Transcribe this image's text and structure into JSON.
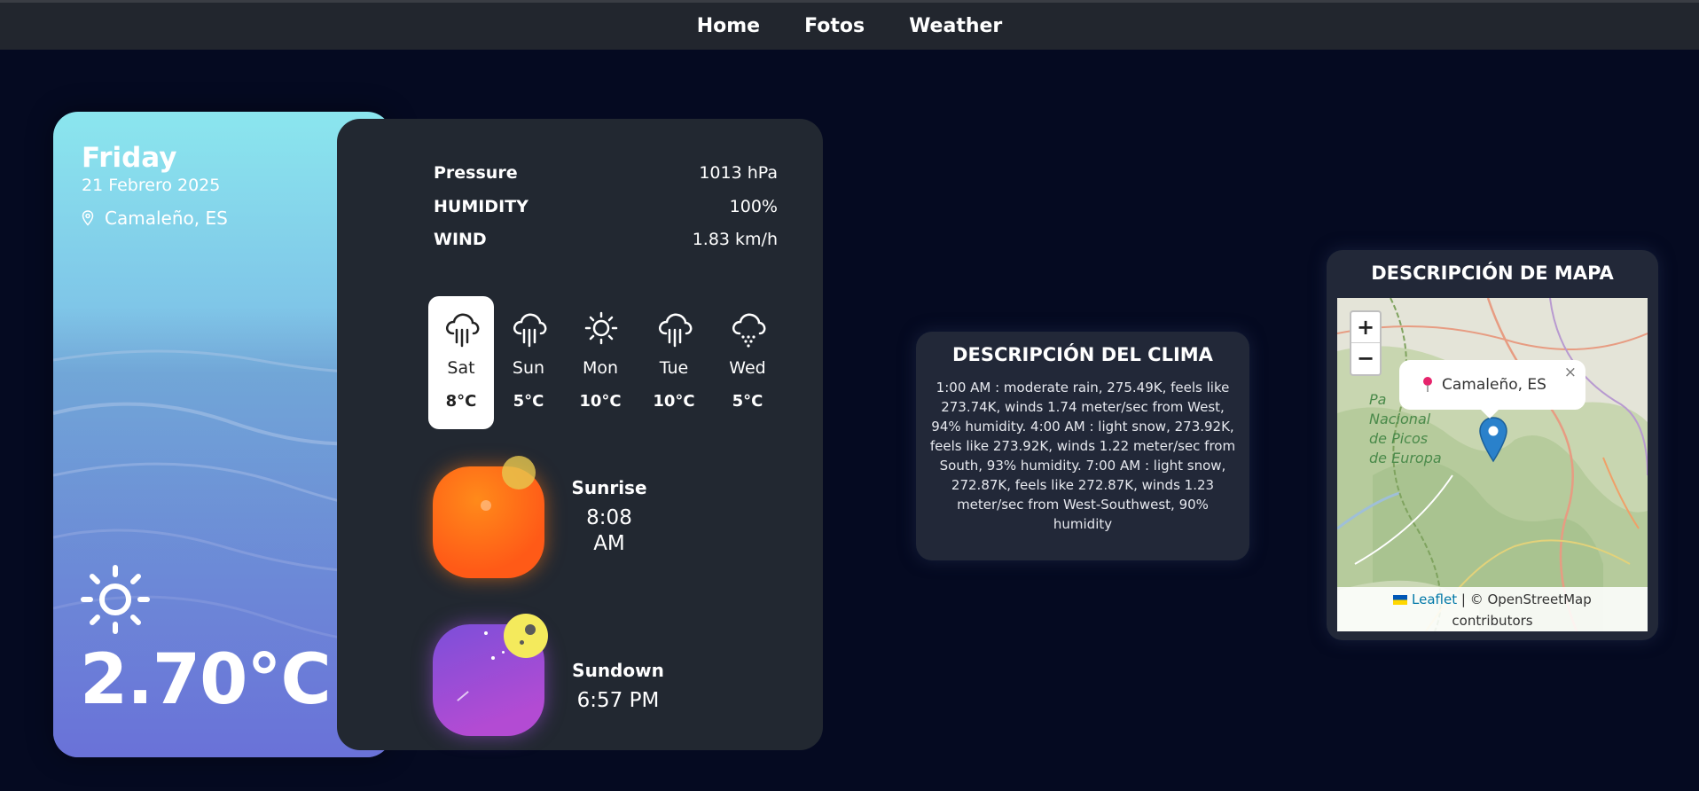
{
  "nav": {
    "items": [
      "Home",
      "Fotos",
      "Weather"
    ]
  },
  "weather": {
    "day": "Friday",
    "date": "21 Febrero 2025",
    "location": "Camaleño, ES",
    "temperature": "2.70°C",
    "icon": "sun-icon"
  },
  "details": {
    "pressure_label": "Pressure",
    "pressure_value": "1013 hPa",
    "humidity_label": "HUMIDITY",
    "humidity_value": "100%",
    "wind_label": "WIND",
    "wind_value": "1.83 km/h"
  },
  "forecast": [
    {
      "day": "Sat",
      "temp": "8°C",
      "icon": "rain-cloud-icon",
      "active": true
    },
    {
      "day": "Sun",
      "temp": "5°C",
      "icon": "rain-cloud-icon",
      "active": false
    },
    {
      "day": "Mon",
      "temp": "10°C",
      "icon": "sun-icon",
      "active": false
    },
    {
      "day": "Tue",
      "temp": "10°C",
      "icon": "rain-cloud-icon",
      "active": false
    },
    {
      "day": "Wed",
      "temp": "5°C",
      "icon": "snow-cloud-icon",
      "active": false
    }
  ],
  "sun": {
    "sunrise_label": "Sunrise",
    "sunrise_time_1": "8:08",
    "sunrise_time_2": "AM",
    "sundown_label": "Sundown",
    "sundown_time": "6:57 PM"
  },
  "clima": {
    "title": "DESCRIPCIÓN DEL CLIMA",
    "text": "1:00 AM : moderate rain, 275.49K, feels like 273.74K, winds 1.74 meter/sec from West, 94% humidity. 4:00 AM : light snow, 273.92K, feels like 273.92K, winds 1.22 meter/sec from South, 93% humidity. 7:00 AM : light snow, 272.87K, feels like 272.87K, winds 1.23 meter/sec from West-Southwest, 90% humidity"
  },
  "map": {
    "title": "DESCRIPCIÓN DE MAPA",
    "zoom_in": "+",
    "zoom_out": "−",
    "popup": "Camaleño, ES",
    "popup_close": "×",
    "park_label_1": "Pa",
    "park_label_2": "Nacional",
    "park_label_3": "de Picos",
    "park_label_4": "de Europa",
    "attribution_link": "Leaflet",
    "attribution_text": "| © OpenStreetMap",
    "attribution_text_2": "contributors"
  }
}
